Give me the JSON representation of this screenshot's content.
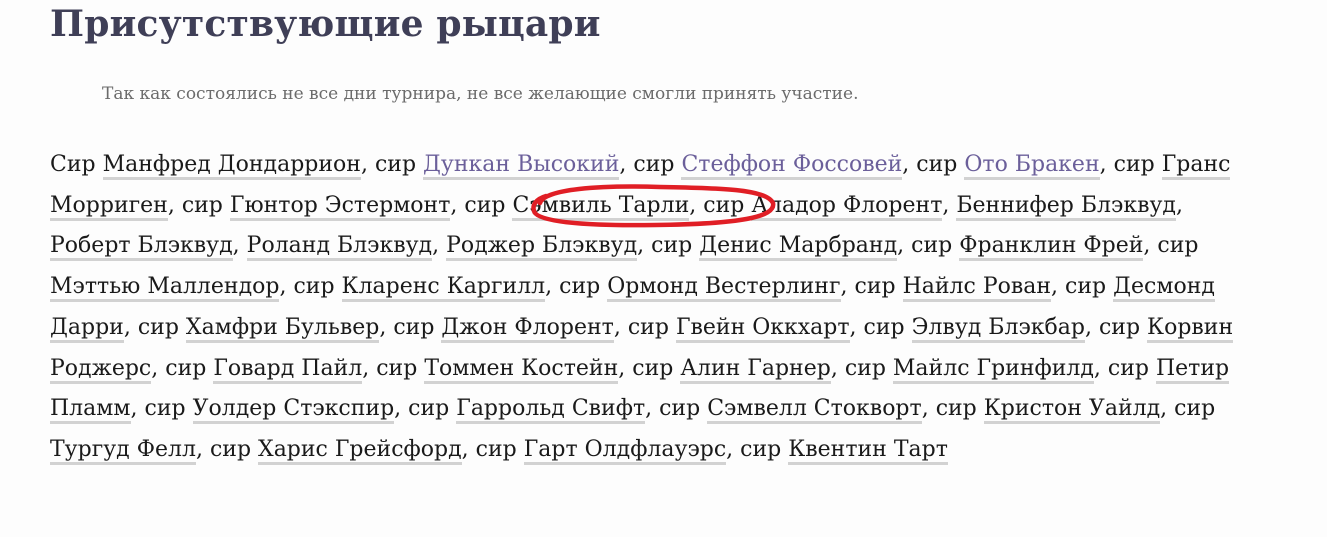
{
  "heading": "Присутствующие рыцари",
  "note": "Так как состоялись не все дни турнира, не все желающие смогли принять участие.",
  "prefix": "сир",
  "first_prefix": "Сир",
  "knights": [
    {
      "name": "Манфред Дондаррион",
      "visited": false
    },
    {
      "name": "Дункан Высокий",
      "visited": true
    },
    {
      "name": "Стеффон Фоссовей",
      "visited": true
    },
    {
      "name": "Ото Бракен",
      "visited": true
    },
    {
      "name": "Гранс Морриген",
      "visited": false
    },
    {
      "name": "Гюнтор Эстермонт",
      "visited": false
    },
    {
      "name": "Сэмвиль Тарли",
      "visited": false,
      "highlighted": true
    },
    {
      "name": "Аладор Флорент",
      "visited": false
    },
    {
      "name": "Беннифер Блэквуд",
      "visited": false,
      "no_prefix": true
    },
    {
      "name": "Роберт Блэквуд",
      "visited": false,
      "no_prefix": true
    },
    {
      "name": "Роланд Блэквуд",
      "visited": false,
      "no_prefix": true
    },
    {
      "name": "Роджер Блэквуд",
      "visited": false,
      "no_prefix": true
    },
    {
      "name": "Денис Марбранд",
      "visited": false
    },
    {
      "name": "Франклин Фрей",
      "visited": false
    },
    {
      "name": "Мэттью Маллендор",
      "visited": false
    },
    {
      "name": "Кларенс Каргилл",
      "visited": false
    },
    {
      "name": "Ормонд Вестерлинг",
      "visited": false
    },
    {
      "name": "Найлс Рован",
      "visited": false
    },
    {
      "name": "Десмонд Дарри",
      "visited": false
    },
    {
      "name": "Хамфри Бульвер",
      "visited": false
    },
    {
      "name": "Джон Флорент",
      "visited": false
    },
    {
      "name": "Гвейн Оккхарт",
      "visited": false
    },
    {
      "name": "Элвуд Блэкбар",
      "visited": false
    },
    {
      "name": "Корвин Роджерс",
      "visited": false
    },
    {
      "name": "Говард Пайл",
      "visited": false
    },
    {
      "name": "Томмен Костейн",
      "visited": false
    },
    {
      "name": "Алин Гарнер",
      "visited": false
    },
    {
      "name": "Майлс Гринфилд",
      "visited": false
    },
    {
      "name": "Петир Пламм",
      "visited": false
    },
    {
      "name": "Уолдер Стэкспир",
      "visited": false
    },
    {
      "name": "Гаррольд Свифт",
      "visited": false
    },
    {
      "name": "Сэмвелл Стокворт",
      "visited": false
    },
    {
      "name": "Кристон Уайлд",
      "visited": false
    },
    {
      "name": "Тургуд Фелл",
      "visited": false
    },
    {
      "name": "Харис Грейсфорд",
      "visited": false
    },
    {
      "name": "Гарт Олдфлауэрс",
      "visited": false
    },
    {
      "name": "Квентин Тарт",
      "visited": false
    }
  ],
  "colors": {
    "heading": "#3f3f57",
    "link_visited": "#6b5f9a",
    "underline": "#d2d2d2",
    "highlight_ring": "#e01e25"
  }
}
